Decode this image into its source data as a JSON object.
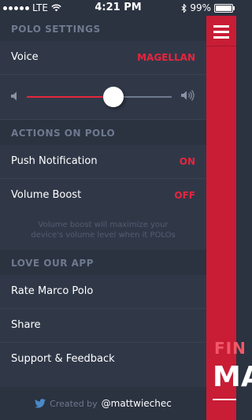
{
  "status_bar": {
    "carrier": "LTE",
    "time": "4:21 PM",
    "battery": "99%"
  },
  "settings": {
    "header": "POLO SETTINGS",
    "voice_label": "Voice",
    "voice_value": "MAGELLAN",
    "volume_level": 0.6
  },
  "actions": {
    "header": "ACTIONS ON POLO",
    "push_label": "Push Notification",
    "push_value": "ON",
    "boost_label": "Volume Boost",
    "boost_value": "OFF",
    "boost_note": "Volume boost will maximize your device's volume level when it POLOs"
  },
  "love": {
    "header": "LOVE OUR APP",
    "items": [
      "Rate Marco Polo",
      "Share",
      "Support & Feedback"
    ]
  },
  "footer": {
    "created_by": "Created by",
    "handle": "@mattwiechec"
  },
  "content": {
    "line1": "FIN",
    "line2": "MA"
  },
  "colors": {
    "accent": "#e8253d",
    "panel": "#303848",
    "header_bg": "#2b3240",
    "content_bg": "#c81d35"
  },
  "icons": [
    "signal-dots-icon",
    "wifi-icon",
    "bluetooth-icon",
    "battery-icon",
    "volume-low-icon",
    "volume-high-icon",
    "twitter-bird-icon",
    "hamburger-menu-icon"
  ]
}
